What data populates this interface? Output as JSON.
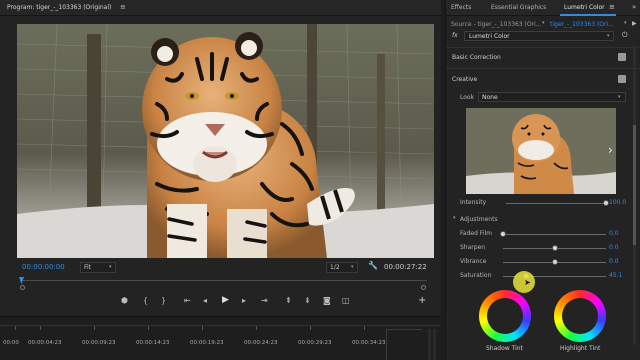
{
  "program": {
    "title": "Program: tiger_-_103363 (Original)",
    "menu_icon": "hamburger-icon",
    "timecode_current": "00:00:00:00",
    "fit": "Fit",
    "resolution": "1/2",
    "timecode_end": "00:00:27:22",
    "controls": [
      "marker-icon",
      "in-point-icon",
      "out-point-icon",
      "go-to-in-icon",
      "step-back-icon",
      "play-icon",
      "step-forward-icon",
      "go-to-out-icon",
      "lift-icon",
      "extract-icon",
      "export-frame-icon",
      "compare-icon",
      "add-icon"
    ]
  },
  "tabs": {
    "effects": "Effects",
    "essential_graphics": "Essential Graphics",
    "lumetri": "Lumetri Color",
    "overflow": "»"
  },
  "source_bar": {
    "source": "Source - tiger_-_103363 (Ori...",
    "target": "tiger_-_103363 (Ori..."
  },
  "fx_row": {
    "fx": "fx",
    "label": "Lumetri Color"
  },
  "basic_correction": {
    "label": "Basic Correction"
  },
  "creative": {
    "label": "Creative",
    "look_label": "Look",
    "look_value": "None",
    "intensity_label": "Intensity",
    "intensity_value": "100.0",
    "intensity_fraction": 1.0,
    "adjustments_label": "Adjustments",
    "sliders": [
      {
        "label": "Faded Film",
        "value": "0.0",
        "fraction": 0.0
      },
      {
        "label": "Sharpen",
        "value": "0.0",
        "fraction": 0.5
      },
      {
        "label": "Vibrance",
        "value": "0.0",
        "fraction": 0.5
      },
      {
        "label": "Saturation",
        "value": "45.1",
        "fraction": 0.225
      }
    ],
    "shadow_tint": "Shadow Tint",
    "highlight_tint": "Highlight Tint"
  },
  "timeline": {
    "ticks": [
      "00:00",
      "00:00:04:23",
      "00:00:09:23",
      "00:00:14:23",
      "00:00:19:23",
      "00:00:24:23",
      "00:00:29:23",
      "00:00:34:23"
    ]
  },
  "colors": {
    "accent_blue": "#2d8ceb",
    "cursor_highlight": "#e8e43a"
  }
}
